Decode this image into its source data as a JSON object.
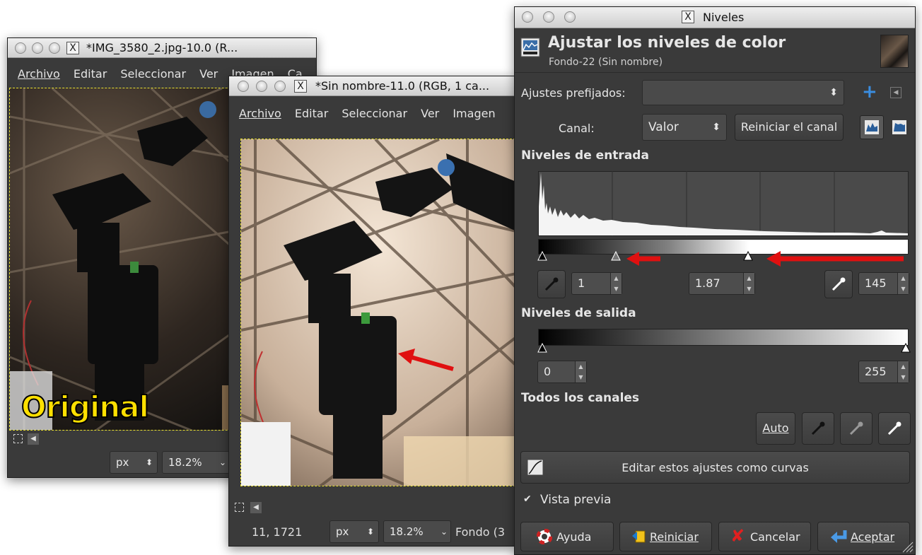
{
  "window_original": {
    "title": "*IMG_3580_2.jpg-10.0 (R...",
    "menu": [
      "Archivo",
      "Editar",
      "Seleccionar",
      "Ver",
      "Imagen",
      "Ca"
    ],
    "overlay_label": "Original",
    "unit": "px",
    "zoom": "18.2%"
  },
  "window_edited": {
    "title": "*Sin nombre-11.0 (RGB, 1 ca...",
    "menu": [
      "Archivo",
      "Editar",
      "Seleccionar",
      "Ver",
      "Imagen"
    ],
    "coords": "11, 1721",
    "unit": "px",
    "zoom": "18.2%",
    "layer": "Fondo (3"
  },
  "levels_dialog": {
    "window_title": "Niveles",
    "heading": "Ajustar los niveles de color",
    "subheading": "Fondo-22 (Sin nombre)",
    "presets_label": "Ajustes prefijados:",
    "presets_value": "",
    "channel_label": "Canal:",
    "channel_value": "Valor",
    "reset_channel": "Reiniciar el canal",
    "input_levels_title": "Niveles de entrada",
    "input_low": "1",
    "input_gamma": "1.87",
    "input_high": "145",
    "output_levels_title": "Niveles de salida",
    "output_low": "0",
    "output_high": "255",
    "all_channels_title": "Todos los canales",
    "auto_label": "Auto",
    "curves_button": "Editar estos ajustes como curvas",
    "preview_label": "Vista previa",
    "preview_checked": true,
    "help_button": "Ayuda",
    "reset_button": "Reiniciar",
    "cancel_button": "Cancelar",
    "accept_button": "Aceptar",
    "accent_color": "#3a8de0",
    "arrow_color": "#e01010"
  }
}
